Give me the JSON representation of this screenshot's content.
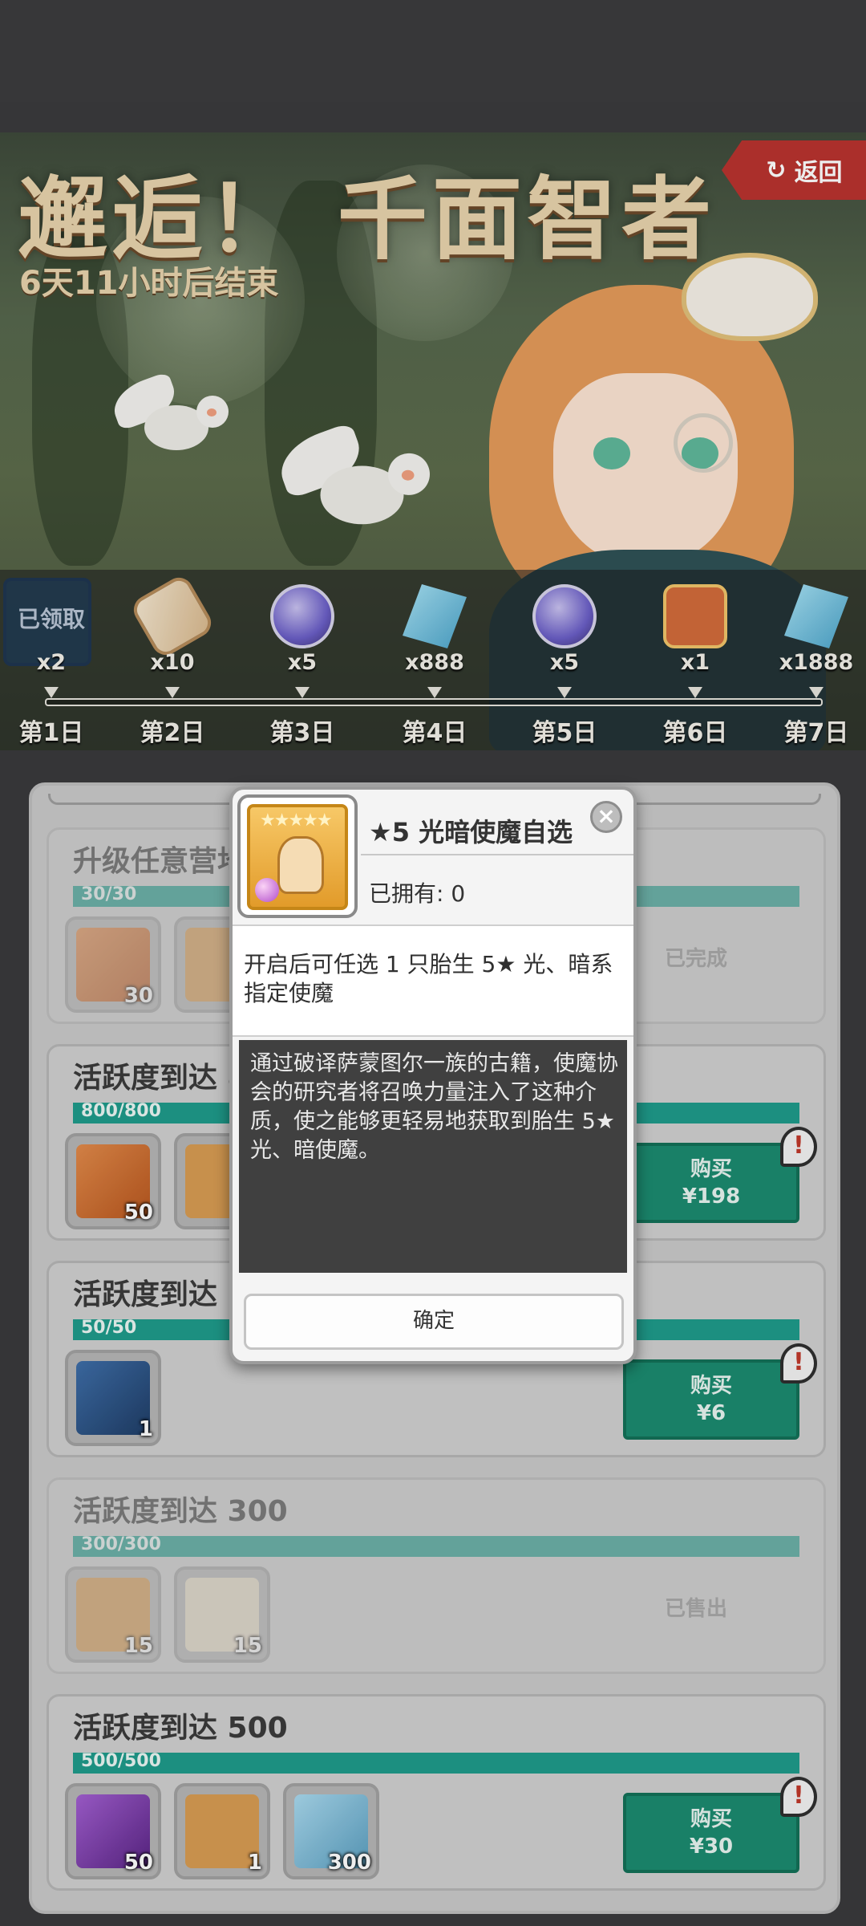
{
  "banner": {
    "title": "邂逅！ 千面智者",
    "countdown": "6天11小时后结束",
    "back_label": "返回",
    "back_icon": "return-arrow-icon"
  },
  "sign_in_track": [
    {
      "day": "第1日",
      "qty": "x2",
      "icon": "card-icon",
      "claimed": true,
      "claimed_label": "已领取"
    },
    {
      "day": "第2日",
      "qty": "x10",
      "icon": "scroll-icon",
      "claimed": false
    },
    {
      "day": "第3日",
      "qty": "x5",
      "icon": "orb-icon",
      "claimed": false
    },
    {
      "day": "第4日",
      "qty": "x888",
      "icon": "crystal-icon",
      "claimed": false
    },
    {
      "day": "第5日",
      "qty": "x5",
      "icon": "orb-icon",
      "claimed": false
    },
    {
      "day": "第6日",
      "qty": "x1",
      "icon": "badge-icon",
      "claimed": false
    },
    {
      "day": "第7日",
      "qty": "x1888",
      "icon": "crystal-icon",
      "claimed": false
    }
  ],
  "tasks": [
    {
      "title": "升级任意营地",
      "progress": "30/30",
      "items": [
        {
          "qty": "30"
        },
        {
          "qty": ""
        }
      ],
      "status": "已完成"
    },
    {
      "title": "活跃度到达 8",
      "progress": "800/800",
      "items": [
        {
          "qty": "50"
        },
        {
          "qty": ""
        }
      ],
      "buy_label": "购买",
      "price": "¥198"
    },
    {
      "title": "活跃度到达 5",
      "progress": "50/50",
      "items": [
        {
          "qty": "1"
        }
      ],
      "buy_label": "购买",
      "price": "¥6"
    },
    {
      "title": "活跃度到达 300",
      "progress": "300/300",
      "items": [
        {
          "qty": "15"
        },
        {
          "qty": "15"
        }
      ],
      "status": "已售出"
    },
    {
      "title": "活跃度到达 500",
      "progress": "500/500",
      "items": [
        {
          "qty": "50"
        },
        {
          "qty": "1"
        },
        {
          "qty": "300"
        }
      ],
      "buy_label": "购买",
      "price": "¥30"
    }
  ],
  "popup": {
    "item_name": "★5 光暗使魔自选",
    "owned": "已拥有: 0",
    "close_icon": "close-icon",
    "summary": "开启后可任选 1 只胎生 5★ 光、暗系指定使魔",
    "description": "通过破译萨蒙图尔一族的古籍，使魔协会的研究者将召唤力量注入了这种介质，使之能够更轻易地获取到胎生 5★ 光、暗使魔。",
    "confirm_label": "确定",
    "stars": "★★★★★"
  },
  "colors": {
    "accent_teal": "#1f9a8a",
    "back_red": "#b8332f",
    "title_gold": "#e8d3ad"
  }
}
